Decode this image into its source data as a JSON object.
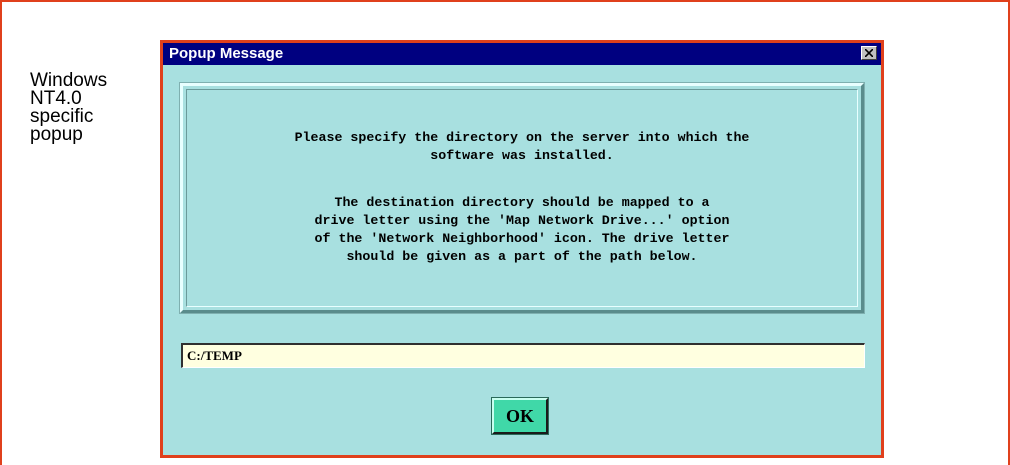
{
  "side_note": {
    "text": "Windows\nNT4.0\nspecific\npopup"
  },
  "dialog": {
    "title": "Popup Message",
    "close_icon": "close-x-icon",
    "message": {
      "paragraph1": "Please specify the directory on the server into which the\nsoftware was installed.",
      "paragraph2": "The destination directory should be mapped to a\ndrive letter using the 'Map Network Drive...' option\nof the 'Network Neighborhood' icon. The drive letter\nshould be given as a part of the path below."
    },
    "path_input": {
      "value": "C:/TEMP"
    },
    "ok_label": "OK"
  },
  "colors": {
    "frame_border": "#e0401c",
    "titlebar": "#000080",
    "dialog_bg": "#a8e0e0",
    "input_bg": "#ffffe0",
    "ok_button": "#40d8a8"
  }
}
